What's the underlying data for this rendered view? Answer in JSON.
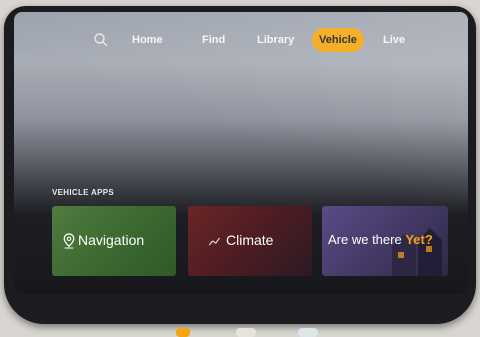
{
  "nav": {
    "search_icon": "search-icon",
    "items": [
      "Home",
      "Find",
      "Library",
      "Vehicle",
      "Live"
    ],
    "active": "Vehicle"
  },
  "section": {
    "title": "VEHICLE APPS"
  },
  "tiles": [
    {
      "label": "Navigation",
      "icon": "map-pin-icon",
      "color": "#4f7c3f"
    },
    {
      "label": "Climate",
      "icon": "fan-icon",
      "color": "#6a2526"
    },
    {
      "label_prefix": "Are we there ",
      "label_highlight": "Yet?",
      "color": "#5b4a86"
    }
  ],
  "colors": {
    "accent": "#f5a50f"
  }
}
